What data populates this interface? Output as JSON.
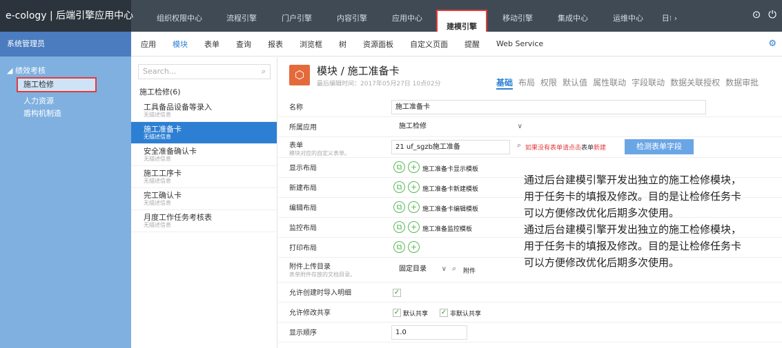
{
  "brand": "e-cology | 后端引擎应用中心",
  "topnav": [
    {
      "label": "组织权限中心"
    },
    {
      "label": "流程引擎"
    },
    {
      "label": "门户引擎"
    },
    {
      "label": "内容引擎"
    },
    {
      "label": "应用中心"
    },
    {
      "label": "建模引擎"
    },
    {
      "label": "移动引擎"
    },
    {
      "label": "集成中心"
    },
    {
      "label": "运维中心"
    },
    {
      "label": "日"
    }
  ],
  "sidebar": {
    "header": "系统管理员",
    "group": "◢ 绩效考核",
    "items": [
      {
        "label": "施工检修"
      },
      {
        "label": "人力资源"
      },
      {
        "label": "盾构机制造"
      }
    ]
  },
  "subnav": [
    "应用",
    "模块",
    "表单",
    "查询",
    "报表",
    "浏览框",
    "树",
    "资源面板",
    "自定义页面",
    "提醒",
    "Web Service"
  ],
  "search": {
    "placeholder": "Search..."
  },
  "list": {
    "title": "施工检修(6)",
    "items": [
      {
        "title": "工具备品设备等录入",
        "desc": "无描述信息"
      },
      {
        "title": "施工准备卡",
        "desc": "无描述信息"
      },
      {
        "title": "安全准备确认卡",
        "desc": "无描述信息"
      },
      {
        "title": "施工工序卡",
        "desc": "无描述信息"
      },
      {
        "title": "完工确认卡",
        "desc": "无描述信息"
      },
      {
        "title": "月度工作任务考核表",
        "desc": "无描述信息"
      }
    ]
  },
  "module": {
    "title": "模块 / 施工准备卡",
    "subtitle": "最后编辑时间：2017年05月27日 10点02分",
    "tabs": [
      "基础",
      "布局",
      "权限",
      "默认值",
      "属性联动",
      "字段联动",
      "数据关联授权",
      "数据审批"
    ]
  },
  "form": {
    "name_label": "名称",
    "name_value": "施工准备卡",
    "app_label": "所属应用",
    "app_value": "施工检修",
    "table_label": "表单",
    "table_sub": "模块对应的自定义表单。",
    "table_value": "21 uf_sgzb施工准备",
    "table_warn": "如果没有表单请点击",
    "table_warn_mid": "表单",
    "table_warn_link": "新建",
    "detect_btn": "检测表单字段",
    "layouts": [
      {
        "label": "显示布局",
        "template": "施工准备卡显示模板"
      },
      {
        "label": "新建布局",
        "template": "施工准备卡新建模板"
      },
      {
        "label": "编辑布局",
        "template": "施工准备卡编辑模板"
      },
      {
        "label": "监控布局",
        "template": "施工准备监控模板"
      },
      {
        "label": "打印布局",
        "template": ""
      }
    ],
    "attach_label": "附件上传目录",
    "attach_sub": "表单附件存放的文档目录。",
    "attach_value": "固定目录",
    "attach_link": "附件",
    "import_label": "允许创建时导入明细",
    "share_label": "允许修改共享",
    "share_default": "默认共享",
    "share_nondefault": "非默认共享",
    "order_label": "显示顺序",
    "order_value": "1.0"
  },
  "annotation": {
    "p1_line1": "通过后台建模引擎开发出独立的施工检修模块，",
    "p1_line2": "用于任务卡的填报及修改。目的是让检修任务卡",
    "p1_line3": "可以方便修改优化后期多次使用。",
    "p2_line1": "通过后台建模引擎开发出独立的施工检修模块，",
    "p2_line2": "用于任务卡的填报及修改。目的是让检修任务卡",
    "p2_line3": "可以方便修改优化后期多次使用。"
  },
  "colors": {
    "accent": "#2d7fd3",
    "highlight": "#e23b3b",
    "sidebar": "#7fb0e0",
    "topbar": "#3f4a55"
  }
}
